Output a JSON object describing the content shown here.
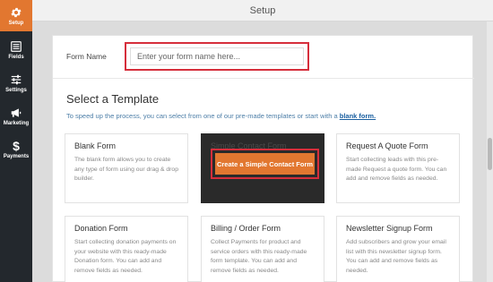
{
  "colors": {
    "sidebar_bg": "#23282d",
    "accent_orange": "#e27730",
    "highlight_red": "#d62e3b",
    "link_blue": "#1a5fa0"
  },
  "window": {
    "title": "Setup"
  },
  "sidebar": {
    "items": [
      {
        "label": "Setup",
        "icon": "gear-icon",
        "active": true
      },
      {
        "label": "Fields",
        "icon": "fields-list-icon"
      },
      {
        "label": "Settings",
        "icon": "sliders-icon"
      },
      {
        "label": "Marketing",
        "icon": "megaphone-icon"
      },
      {
        "label": "Payments",
        "icon": "dollar-icon"
      }
    ]
  },
  "form_name": {
    "label": "Form Name",
    "placeholder": "Enter your form name here...",
    "value": ""
  },
  "templates": {
    "heading": "Select a Template",
    "description": "To speed up the process, you can select from one of our pre-made templates or start with a",
    "blank_link": "blank form.",
    "cards": [
      {
        "title": "Blank Form",
        "desc": "The blank form allows you to create any type of form using our drag & drop builder."
      },
      {
        "title": "Simple Contact Form",
        "button": "Create a Simple Contact Form"
      },
      {
        "title": "Request A Quote Form",
        "desc": "Start collecting leads with this pre-made Request a quote form. You can add and remove fields as needed."
      },
      {
        "title": "Donation Form",
        "desc": "Start collecting donation payments on your website with this ready-made Donation form. You can add and remove fields as needed."
      },
      {
        "title": "Billing / Order Form",
        "desc": "Collect Payments for product and service orders with this ready-made form template. You can add and remove fields as needed."
      },
      {
        "title": "Newsletter Signup Form",
        "desc": "Add subscribers and grow your email list with this newsletter signup form. You can add and remove fields as needed."
      }
    ]
  }
}
